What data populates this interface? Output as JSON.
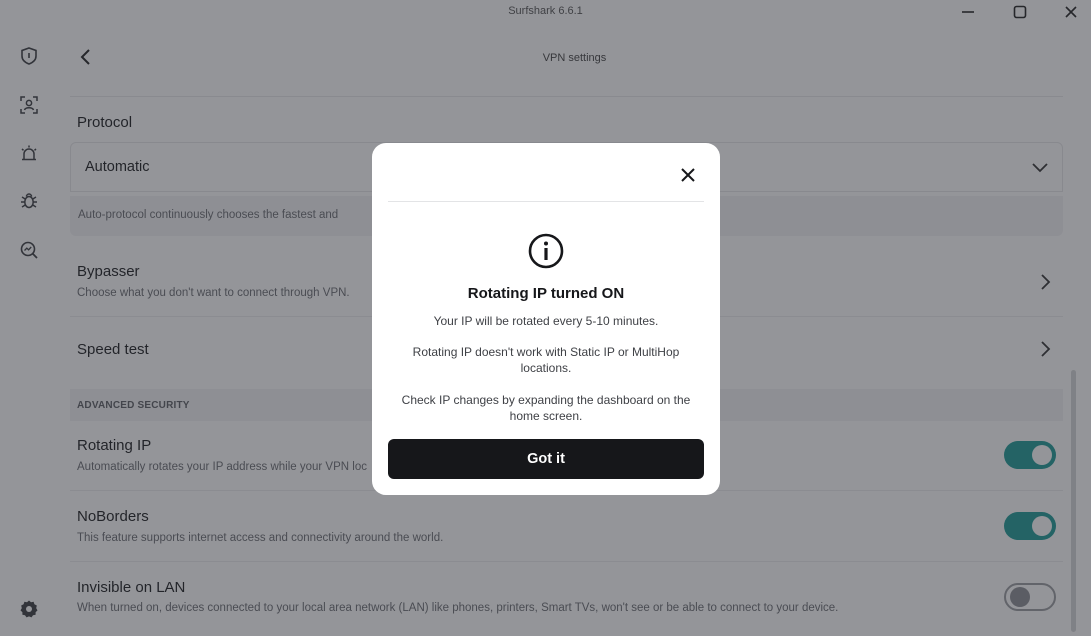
{
  "window": {
    "title": "Surfshark 6.6.1"
  },
  "header": {
    "title": "VPN settings"
  },
  "protocol": {
    "label": "Protocol",
    "selected": "Automatic",
    "description": "Auto-protocol continuously chooses the fastest and"
  },
  "bypasser": {
    "label": "Bypasser",
    "description": "Choose what you don't want to connect through VPN."
  },
  "speed_test": {
    "label": "Speed test"
  },
  "advanced_security": {
    "heading": "ADVANCED SECURITY",
    "rotating_ip": {
      "label": "Rotating IP",
      "description": "Automatically rotates your IP address while your VPN loc",
      "enabled": true
    },
    "noborders": {
      "label": "NoBorders",
      "description": "This feature supports internet access and connectivity around the world.",
      "enabled": true
    },
    "invisible_on_lan": {
      "label": "Invisible on LAN",
      "description": "When turned on, devices connected to your local area network (LAN) like phones, printers, Smart TVs, won't see or be able to connect to your device.",
      "enabled": false
    }
  },
  "modal": {
    "title": "Rotating IP turned ON",
    "line1": "Your IP will be rotated every 5-10 minutes.",
    "line2": "Rotating IP doesn't work with Static IP or MultiHop locations.",
    "line3": "Check IP changes by expanding the dashboard on the home screen.",
    "button_label": "Got it"
  },
  "colors": {
    "toggle_on": "#1f9a97",
    "modal_button": "#16171a",
    "overlay": "#2a2c34"
  },
  "icons": {
    "sidebar": [
      "shield-icon",
      "person-scan-icon",
      "alert-icon",
      "bug-icon",
      "search-chart-icon",
      "gear-icon"
    ]
  }
}
